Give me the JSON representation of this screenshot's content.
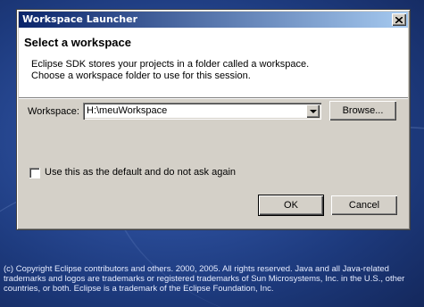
{
  "window": {
    "title": "Workspace Launcher",
    "close_icon": "close-icon"
  },
  "header": {
    "title": "Select a workspace",
    "description_line1": "Eclipse SDK stores your projects in a folder called a workspace.",
    "description_line2": "Choose a workspace folder to use for this session."
  },
  "workspace": {
    "label": "Workspace:",
    "value": "H:\\meuWorkspace",
    "dropdown_icon": "chevron-down-icon",
    "browse_label": "Browse..."
  },
  "default_checkbox": {
    "label": "Use this as the default and do not ask again",
    "checked": false
  },
  "buttons": {
    "ok_label": "OK",
    "cancel_label": "Cancel"
  },
  "footer": {
    "copyright": "(c) Copyright Eclipse contributors and others. 2000, 2005. All rights reserved. Java and all Java-related trademarks and logos are trademarks or registered trademarks of Sun Microsystems, Inc. in the U.S., other countries, or both. Eclipse is a trademark of the Eclipse Foundation, Inc."
  },
  "colors": {
    "title_bar_start": "#0a246a",
    "title_bar_end": "#a6caf0",
    "dialog_face": "#d4d0c8",
    "splash_background": "#2a4c98"
  }
}
